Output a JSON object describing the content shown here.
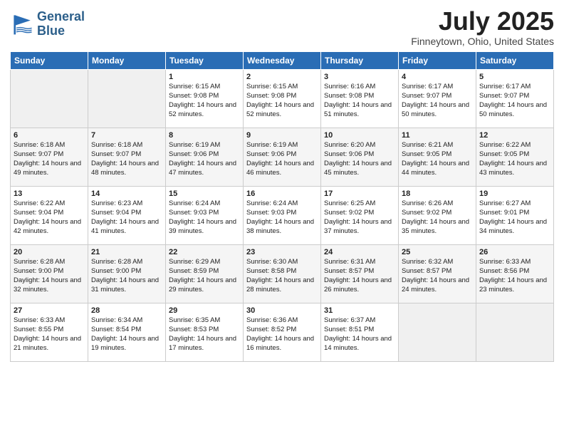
{
  "header": {
    "logo_line1": "General",
    "logo_line2": "Blue",
    "title": "July 2025",
    "subtitle": "Finneytown, Ohio, United States"
  },
  "days_of_week": [
    "Sunday",
    "Monday",
    "Tuesday",
    "Wednesday",
    "Thursday",
    "Friday",
    "Saturday"
  ],
  "weeks": [
    [
      {
        "day": "",
        "info": ""
      },
      {
        "day": "",
        "info": ""
      },
      {
        "day": "1",
        "info": "Sunrise: 6:15 AM\nSunset: 9:08 PM\nDaylight: 14 hours and 52 minutes."
      },
      {
        "day": "2",
        "info": "Sunrise: 6:15 AM\nSunset: 9:08 PM\nDaylight: 14 hours and 52 minutes."
      },
      {
        "day": "3",
        "info": "Sunrise: 6:16 AM\nSunset: 9:08 PM\nDaylight: 14 hours and 51 minutes."
      },
      {
        "day": "4",
        "info": "Sunrise: 6:17 AM\nSunset: 9:07 PM\nDaylight: 14 hours and 50 minutes."
      },
      {
        "day": "5",
        "info": "Sunrise: 6:17 AM\nSunset: 9:07 PM\nDaylight: 14 hours and 50 minutes."
      }
    ],
    [
      {
        "day": "6",
        "info": "Sunrise: 6:18 AM\nSunset: 9:07 PM\nDaylight: 14 hours and 49 minutes."
      },
      {
        "day": "7",
        "info": "Sunrise: 6:18 AM\nSunset: 9:07 PM\nDaylight: 14 hours and 48 minutes."
      },
      {
        "day": "8",
        "info": "Sunrise: 6:19 AM\nSunset: 9:06 PM\nDaylight: 14 hours and 47 minutes."
      },
      {
        "day": "9",
        "info": "Sunrise: 6:19 AM\nSunset: 9:06 PM\nDaylight: 14 hours and 46 minutes."
      },
      {
        "day": "10",
        "info": "Sunrise: 6:20 AM\nSunset: 9:06 PM\nDaylight: 14 hours and 45 minutes."
      },
      {
        "day": "11",
        "info": "Sunrise: 6:21 AM\nSunset: 9:05 PM\nDaylight: 14 hours and 44 minutes."
      },
      {
        "day": "12",
        "info": "Sunrise: 6:22 AM\nSunset: 9:05 PM\nDaylight: 14 hours and 43 minutes."
      }
    ],
    [
      {
        "day": "13",
        "info": "Sunrise: 6:22 AM\nSunset: 9:04 PM\nDaylight: 14 hours and 42 minutes."
      },
      {
        "day": "14",
        "info": "Sunrise: 6:23 AM\nSunset: 9:04 PM\nDaylight: 14 hours and 41 minutes."
      },
      {
        "day": "15",
        "info": "Sunrise: 6:24 AM\nSunset: 9:03 PM\nDaylight: 14 hours and 39 minutes."
      },
      {
        "day": "16",
        "info": "Sunrise: 6:24 AM\nSunset: 9:03 PM\nDaylight: 14 hours and 38 minutes."
      },
      {
        "day": "17",
        "info": "Sunrise: 6:25 AM\nSunset: 9:02 PM\nDaylight: 14 hours and 37 minutes."
      },
      {
        "day": "18",
        "info": "Sunrise: 6:26 AM\nSunset: 9:02 PM\nDaylight: 14 hours and 35 minutes."
      },
      {
        "day": "19",
        "info": "Sunrise: 6:27 AM\nSunset: 9:01 PM\nDaylight: 14 hours and 34 minutes."
      }
    ],
    [
      {
        "day": "20",
        "info": "Sunrise: 6:28 AM\nSunset: 9:00 PM\nDaylight: 14 hours and 32 minutes."
      },
      {
        "day": "21",
        "info": "Sunrise: 6:28 AM\nSunset: 9:00 PM\nDaylight: 14 hours and 31 minutes."
      },
      {
        "day": "22",
        "info": "Sunrise: 6:29 AM\nSunset: 8:59 PM\nDaylight: 14 hours and 29 minutes."
      },
      {
        "day": "23",
        "info": "Sunrise: 6:30 AM\nSunset: 8:58 PM\nDaylight: 14 hours and 28 minutes."
      },
      {
        "day": "24",
        "info": "Sunrise: 6:31 AM\nSunset: 8:57 PM\nDaylight: 14 hours and 26 minutes."
      },
      {
        "day": "25",
        "info": "Sunrise: 6:32 AM\nSunset: 8:57 PM\nDaylight: 14 hours and 24 minutes."
      },
      {
        "day": "26",
        "info": "Sunrise: 6:33 AM\nSunset: 8:56 PM\nDaylight: 14 hours and 23 minutes."
      }
    ],
    [
      {
        "day": "27",
        "info": "Sunrise: 6:33 AM\nSunset: 8:55 PM\nDaylight: 14 hours and 21 minutes."
      },
      {
        "day": "28",
        "info": "Sunrise: 6:34 AM\nSunset: 8:54 PM\nDaylight: 14 hours and 19 minutes."
      },
      {
        "day": "29",
        "info": "Sunrise: 6:35 AM\nSunset: 8:53 PM\nDaylight: 14 hours and 17 minutes."
      },
      {
        "day": "30",
        "info": "Sunrise: 6:36 AM\nSunset: 8:52 PM\nDaylight: 14 hours and 16 minutes."
      },
      {
        "day": "31",
        "info": "Sunrise: 6:37 AM\nSunset: 8:51 PM\nDaylight: 14 hours and 14 minutes."
      },
      {
        "day": "",
        "info": ""
      },
      {
        "day": "",
        "info": ""
      }
    ]
  ]
}
